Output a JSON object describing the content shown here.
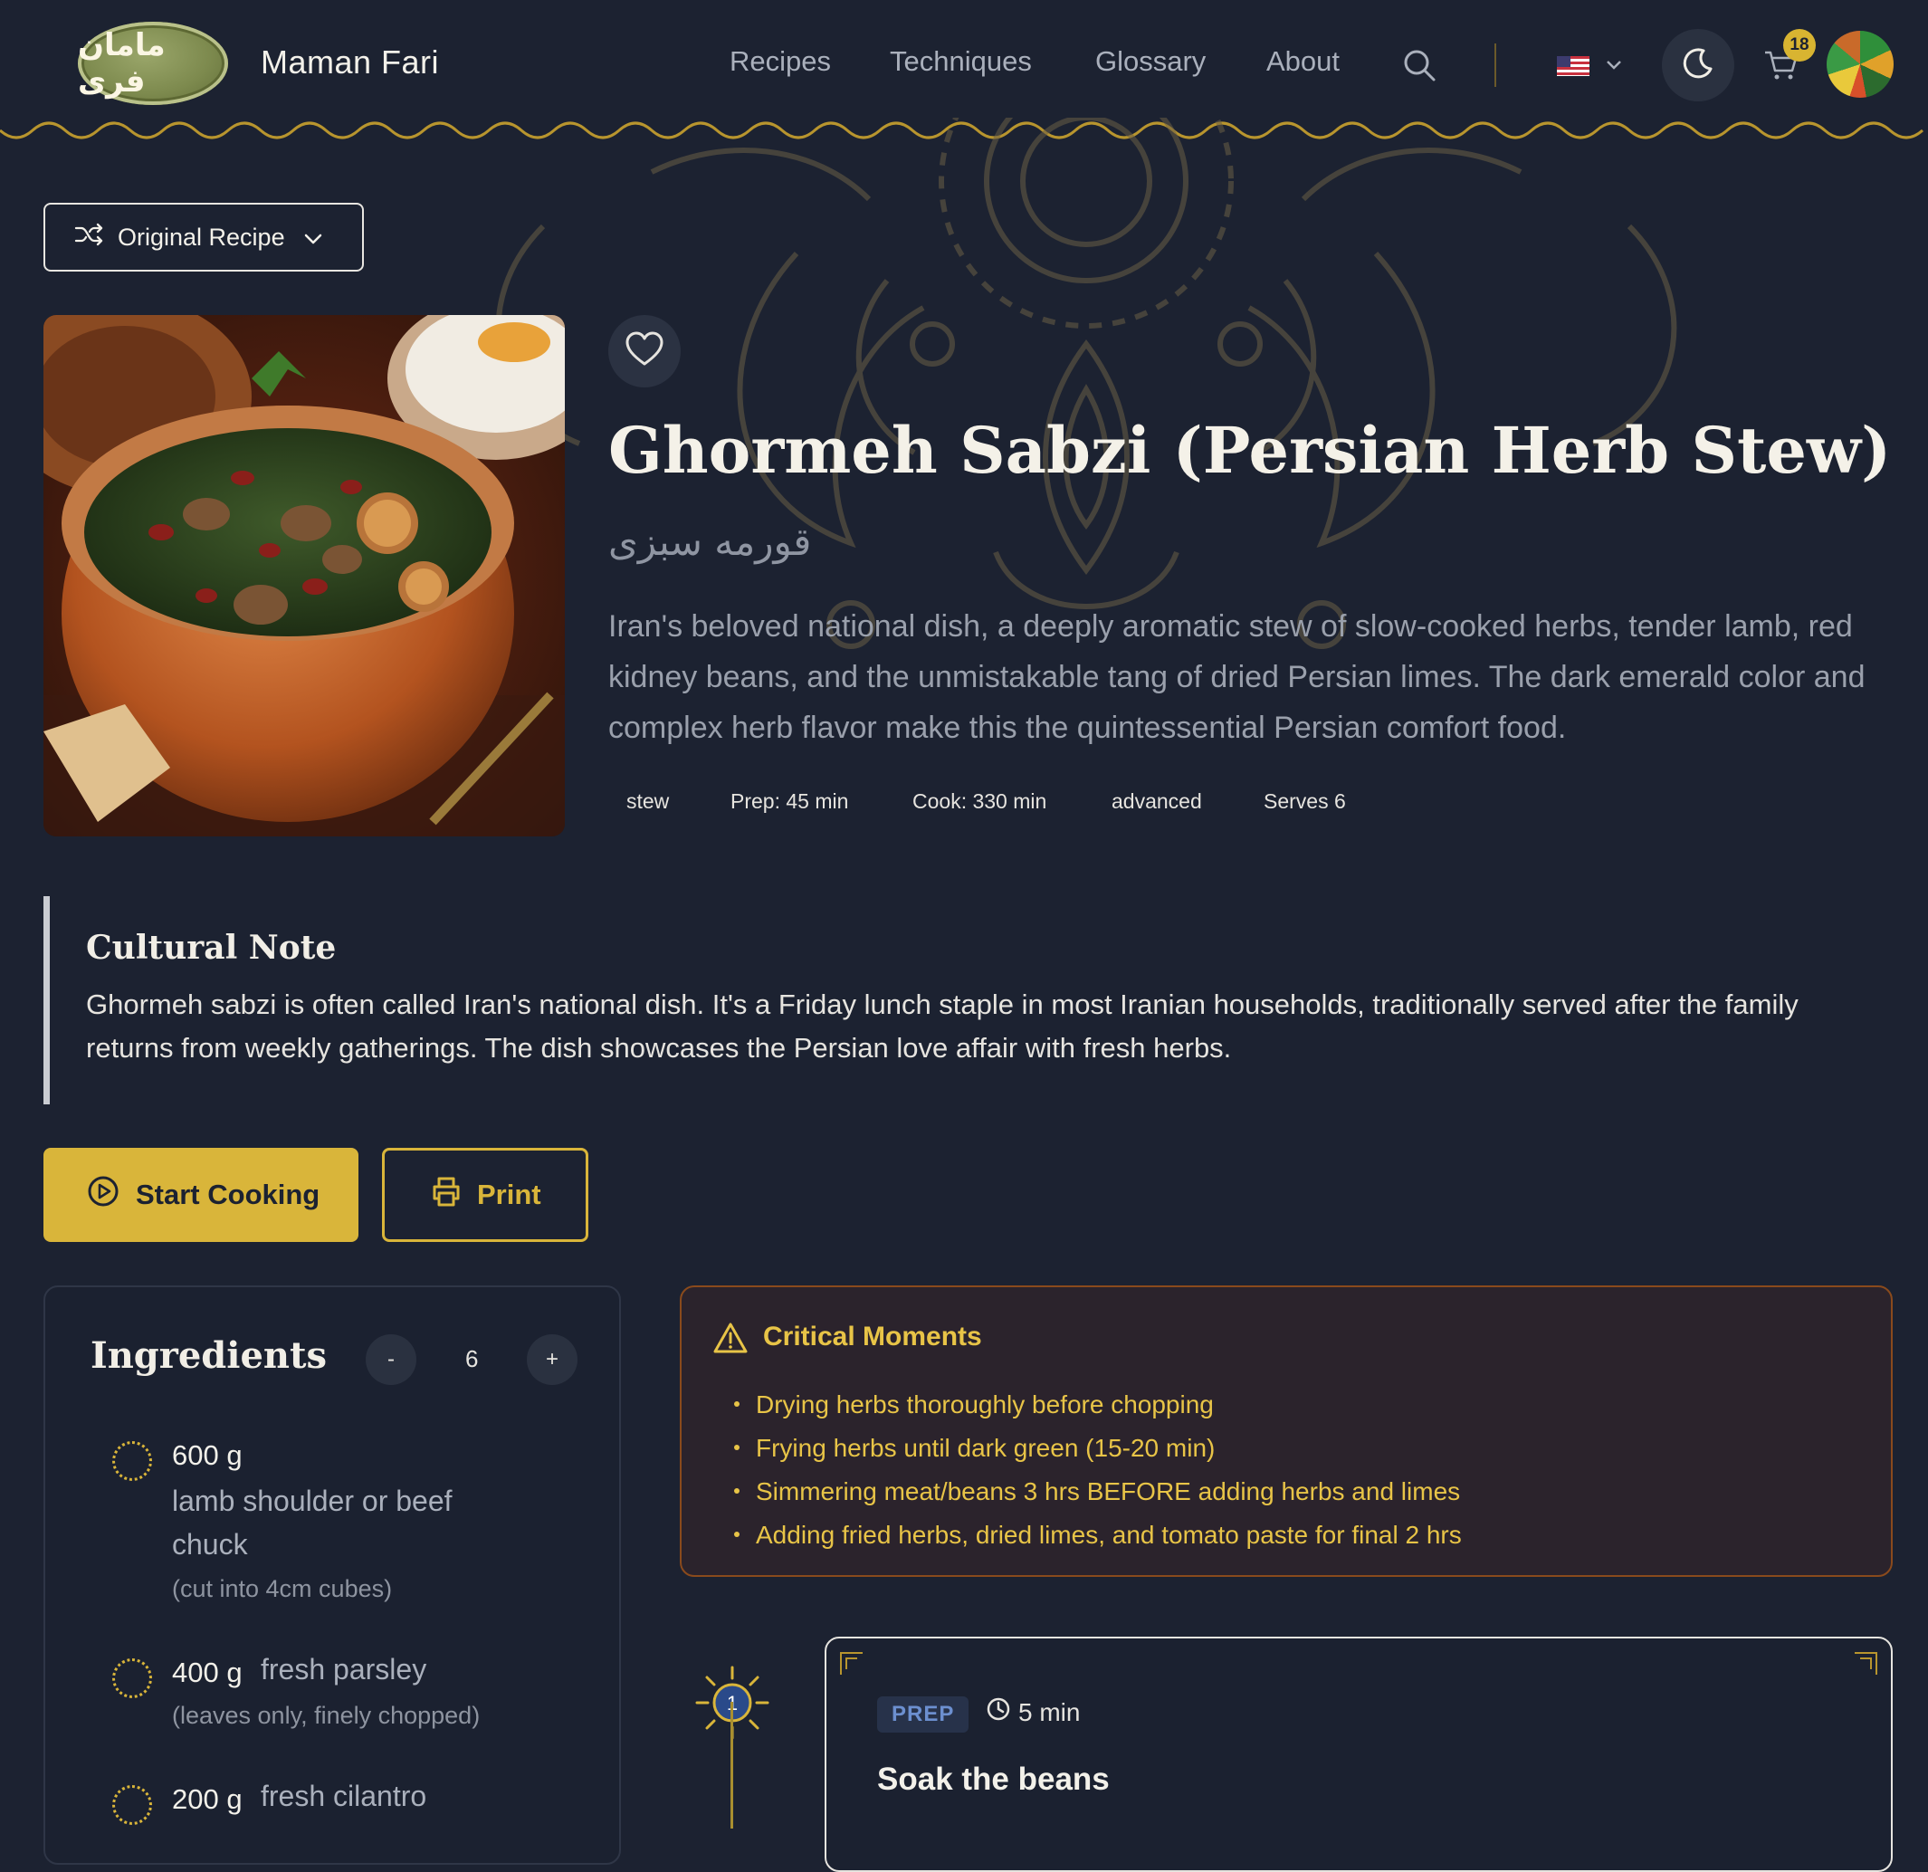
{
  "header": {
    "logo_text": "مامان فری",
    "brand": "Maman Fari",
    "nav": [
      "Recipes",
      "Techniques",
      "Glossary",
      "About"
    ],
    "cart_count": "18",
    "language": "US flag"
  },
  "version": {
    "label": "Original Recipe"
  },
  "recipe": {
    "title": "Ghormeh Sabzi (Persian Herb Stew)",
    "persian_title": "قورمه سبزی",
    "description": "Iran's beloved national dish, a deeply aromatic stew of slow-cooked herbs, tender lamb, red kidney beans, and the unmistakable tang of dried Persian limes. The dark emerald color and complex herb flavor make this the quintessential Persian comfort food.",
    "tags": [
      "stew",
      "Prep: 45 min",
      "Cook: 330 min",
      "advanced",
      "Serves 6"
    ]
  },
  "cultural_note": {
    "title": "Cultural Note",
    "text": "Ghormeh sabzi is often called Iran's national dish. It's a Friday lunch staple in most Iranian households, traditionally served after the family returns from weekly gatherings. The dish showcases the Persian love affair with fresh herbs."
  },
  "actions": {
    "start": "Start Cooking",
    "print": "Print"
  },
  "ingredients": {
    "title": "Ingredients",
    "minus": "-",
    "plus": "+",
    "servings": "6",
    "items": [
      {
        "qty": "600 g",
        "name_line1": "lamb shoulder or beef",
        "name_line2": "chuck",
        "note": "(cut into 4cm cubes)"
      },
      {
        "qty": "400 g",
        "name": "fresh parsley",
        "note": "(leaves only, finely chopped)"
      },
      {
        "qty": "200 g",
        "name": "fresh cilantro"
      }
    ]
  },
  "critical": {
    "title": "Critical Moments",
    "items": [
      "Drying herbs thoroughly before chopping",
      "Frying herbs until dark green (15-20 min)",
      "Simmering meat/beans 3 hrs BEFORE adding herbs and limes",
      "Adding fried herbs, dried limes, and tomato paste for final 2 hrs"
    ]
  },
  "step": {
    "number": "1",
    "badge": "PREP",
    "time": "5 min",
    "title": "Soak the beans"
  },
  "colors": {
    "accent": "#d9b53a",
    "background": "#1c2231",
    "critical_text": "#e8c447"
  }
}
